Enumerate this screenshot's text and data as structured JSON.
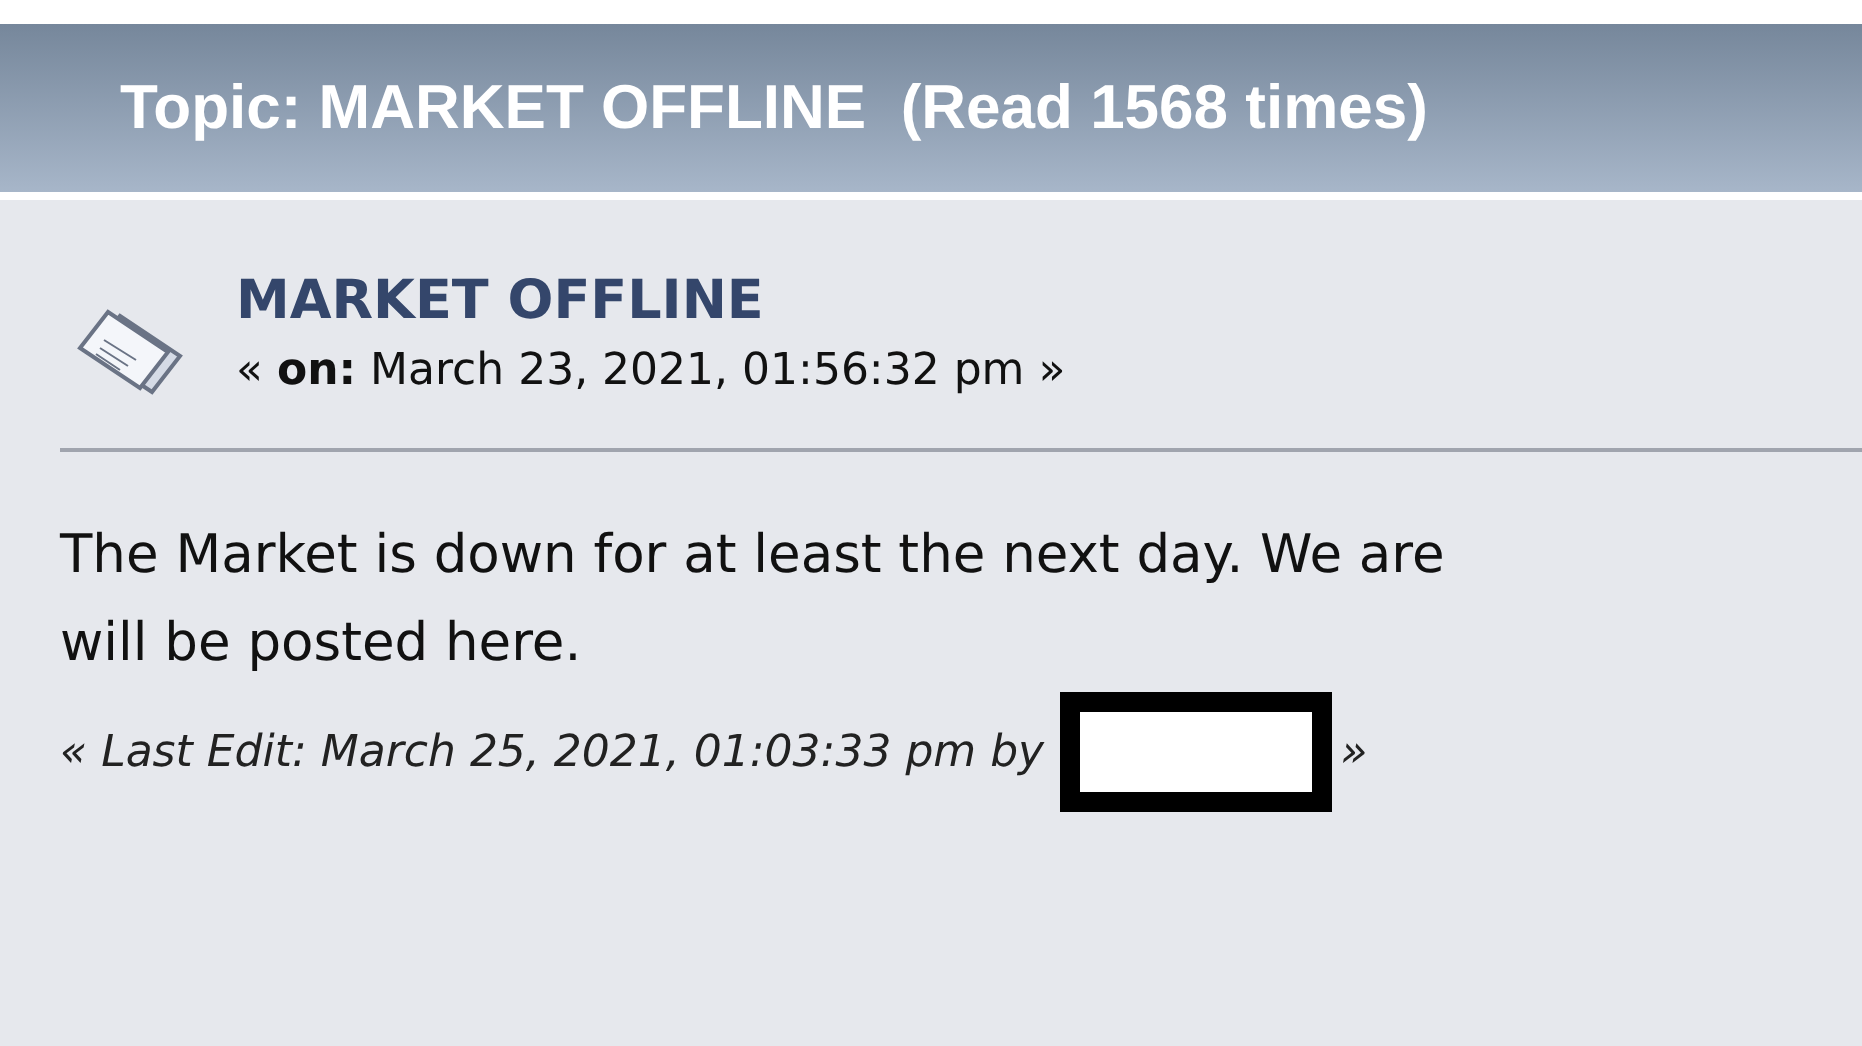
{
  "topic_header": "Topic: MARKET OFFLINE  (Read 1568 times)",
  "post": {
    "title": "MARKET OFFLINE",
    "date_line": "« **on:** March 23, 2021, 01:56:32 pm »",
    "body": [
      "The Market is down for at least the next day. We are",
      "will be posted here."
    ],
    "last_edit": {
      "text": "« Last Edit: March 25, 2021, 01:03:33 pm by",
      "close": "»"
    }
  }
}
